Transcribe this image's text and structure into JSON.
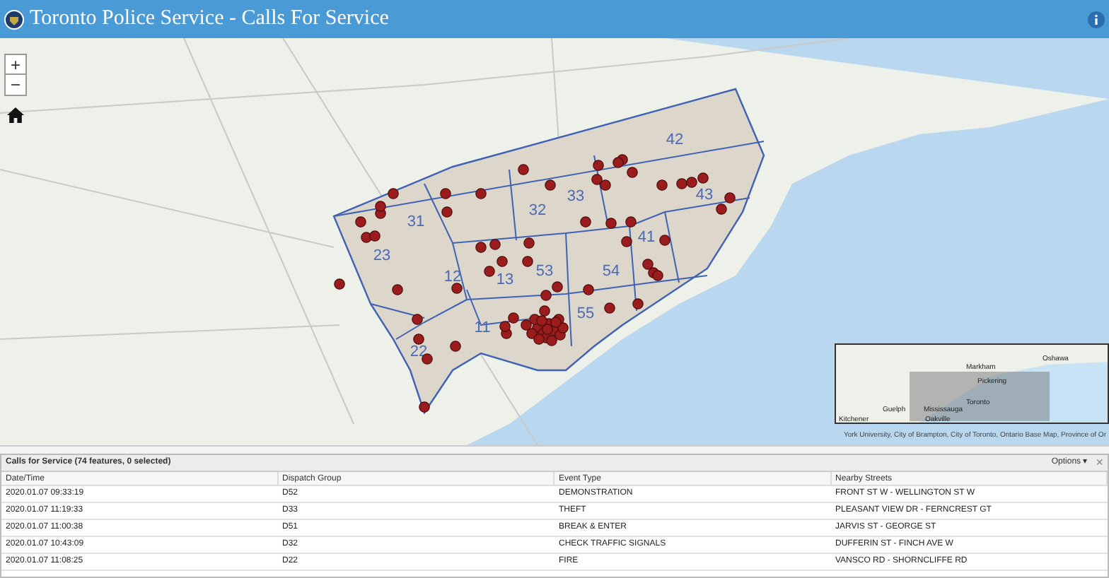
{
  "window": {
    "title": "Toronto Police Service - Calls For Service"
  },
  "map": {
    "zoom_in": "+",
    "zoom_out": "−",
    "attribution": "York University, City of Brampton, City of Toronto, Ontario Base Map, Province of Or",
    "divisions": [
      "42",
      "43",
      "33",
      "32",
      "31",
      "23",
      "12",
      "13",
      "53",
      "54",
      "41",
      "55",
      "11",
      "22"
    ],
    "overview": {
      "labels": [
        "Oshawa",
        "Markham",
        "Pickering",
        "Toronto",
        "Guelph",
        "Mississauga",
        "Kitchener",
        "Oakville"
      ]
    }
  },
  "table": {
    "title": "Calls for Service (74 features, 0 selected)",
    "options": "Options ▾",
    "close": "×",
    "columns": [
      "Date/Time",
      "Dispatch Group",
      "Event Type",
      "Nearby Streets"
    ],
    "rows": [
      [
        "2020.01.07 09:33:19",
        "D52",
        "DEMONSTRATION",
        "FRONT ST W - WELLINGTON ST W"
      ],
      [
        "2020.01.07 11:19:33",
        "D33",
        "THEFT",
        "PLEASANT VIEW DR - FERNCREST GT"
      ],
      [
        "2020.01.07 11:00:38",
        "D51",
        "BREAK & ENTER",
        "JARVIS ST - GEORGE ST"
      ],
      [
        "2020.01.07 10:43:09",
        "D32",
        "CHECK TRAFFIC SIGNALS",
        "DUFFERIN ST - FINCH AVE W"
      ],
      [
        "2020.01.07 11:08:25",
        "D22",
        "FIRE",
        "VANSCO RD - SHORNCLIFFE RD"
      ]
    ]
  }
}
